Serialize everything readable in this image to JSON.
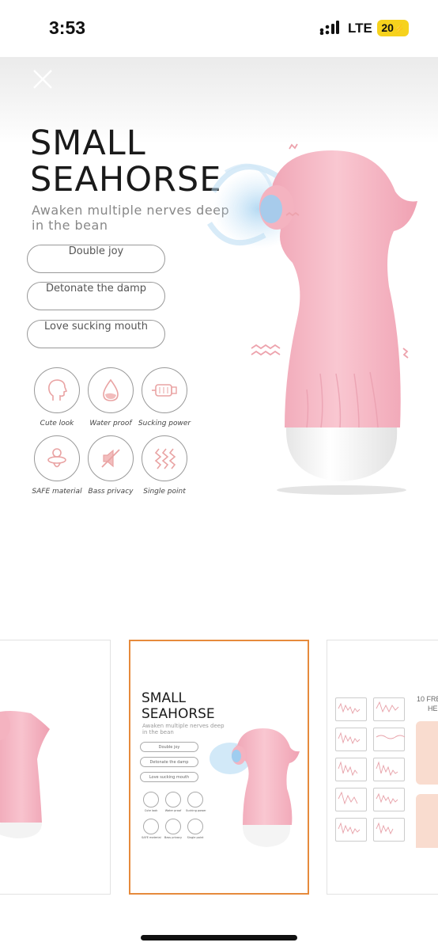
{
  "status_bar": {
    "time": "3:53",
    "network": "LTE",
    "battery": "20"
  },
  "product": {
    "title_line1": "SMALL",
    "title_line2": "SEAHORSE",
    "subtitle": "Awaken multiple nerves deep in the bean",
    "pills": [
      "Double joy",
      "Detonate the damp",
      "Love sucking mouth"
    ],
    "features": [
      {
        "label": "Cute look",
        "icon": "head-profile-icon"
      },
      {
        "label": "Water proof",
        "icon": "water-drop-icon"
      },
      {
        "label": "Sucking power",
        "icon": "motor-icon"
      },
      {
        "label": "SAFE material",
        "icon": "pacifier-icon"
      },
      {
        "label": "Bass privacy",
        "icon": "mute-speaker-icon"
      },
      {
        "label": "Single point",
        "icon": "wave-lines-icon"
      }
    ]
  },
  "thumbnail_gallery": {
    "selected_index": 1,
    "thumbnails": [
      {
        "title_line1": "",
        "title_line2": "",
        "heading": ""
      },
      {
        "title_line1": "SMALL",
        "title_line2": "SEAHORSE",
        "subtitle": "Awaken multiple nerves deep in the bean",
        "pills": [
          "Double joy",
          "Detonate the damp",
          "Love sucking mouth"
        ],
        "features": [
          "Cute look",
          "Water proof",
          "Sucking power",
          "SAFE material",
          "Bass privacy",
          "Single point"
        ]
      },
      {
        "heading_line1": "10 FRE",
        "heading_line2": "HE"
      }
    ]
  },
  "colors": {
    "accent_orange": "#e68a3c",
    "product_pink": "#f6b6c4",
    "product_white": "#f3f3f3",
    "motion_blue": "#b9dcf3"
  }
}
